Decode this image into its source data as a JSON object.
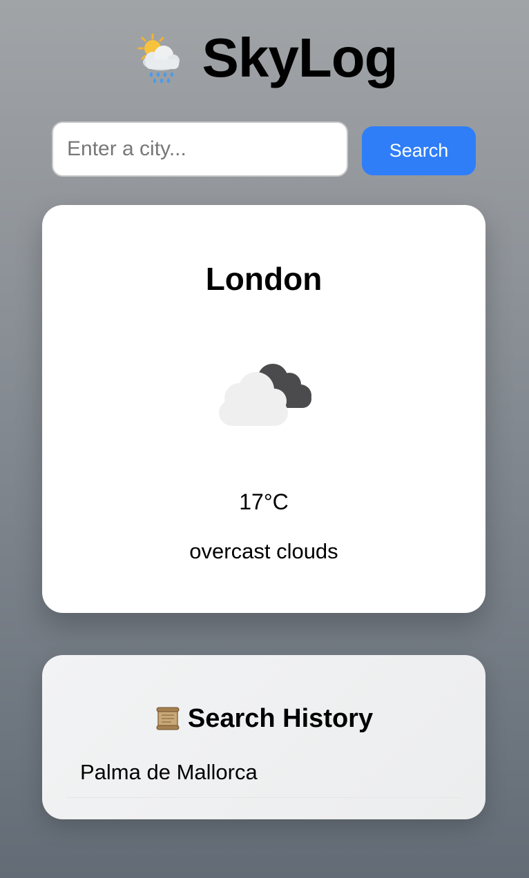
{
  "app": {
    "title": "SkyLog",
    "logo_icon": "sun-behind-rain-cloud-icon"
  },
  "search": {
    "placeholder": "Enter a city...",
    "value": "",
    "button_label": "Search"
  },
  "weather": {
    "city": "London",
    "icon": "overcast-clouds-icon",
    "temperature": "17°C",
    "description": "overcast clouds"
  },
  "history": {
    "icon": "scroll-icon",
    "title": "Search History",
    "items": [
      {
        "label": "Palma de Mallorca"
      }
    ]
  },
  "colors": {
    "accent": "#2f7ef8",
    "card_background": "#ffffff",
    "page_gradient_top": "#a1a4a7",
    "page_gradient_bottom": "#636c76"
  }
}
